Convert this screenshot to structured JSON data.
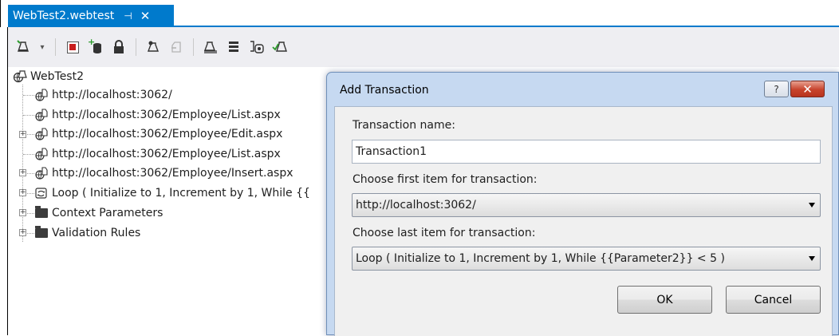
{
  "tab": {
    "title": "WebTest2.webtest",
    "pin_glyph": "⊣",
    "close_glyph": "✕"
  },
  "toolbar": {
    "icons": [
      "add-request-icon",
      "dropdown-arrow-icon",
      "stop-recording-icon",
      "add-datasource-icon",
      "credentials-icon",
      "insert-request-icon",
      "remove-request-icon",
      "parameterize-icon",
      "add-validation-icon",
      "generate-code-icon",
      "run-test-icon"
    ]
  },
  "tree": {
    "root": "WebTest2",
    "items": [
      {
        "label": "http://localhost:3062/",
        "expandable": false,
        "icon": "web-request-icon"
      },
      {
        "label": "http://localhost:3062/Employee/List.aspx",
        "expandable": false,
        "icon": "web-request-icon"
      },
      {
        "label": "http://localhost:3062/Employee/Edit.aspx",
        "expandable": true,
        "icon": "web-request-icon"
      },
      {
        "label": "http://localhost:3062/Employee/List.aspx",
        "expandable": false,
        "icon": "web-request-icon"
      },
      {
        "label": "http://localhost:3062/Employee/Insert.aspx",
        "expandable": true,
        "icon": "web-request-icon"
      },
      {
        "label": "Loop ( Initialize to 1, Increment by 1, While {{",
        "expandable": true,
        "icon": "loop-icon"
      },
      {
        "label": "Context Parameters",
        "expandable": true,
        "icon": "folder-icon"
      },
      {
        "label": "Validation Rules",
        "expandable": true,
        "icon": "folder-icon"
      }
    ]
  },
  "dialog": {
    "title": "Add Transaction",
    "help_glyph": "?",
    "close_glyph": "✕",
    "name_label": "Transaction name:",
    "name_value": "Transaction1",
    "first_label": "Choose first item for transaction:",
    "first_value": "http://localhost:3062/",
    "last_label": "Choose last item for transaction:",
    "last_value": "Loop ( Initialize to 1, Increment by 1, While {{Parameter2}} < 5 )",
    "ok_label": "OK",
    "cancel_label": "Cancel"
  },
  "colors": {
    "accent": "#007acc",
    "dialog_frame": "#c6d9f1",
    "close_button": "#c7432c"
  }
}
